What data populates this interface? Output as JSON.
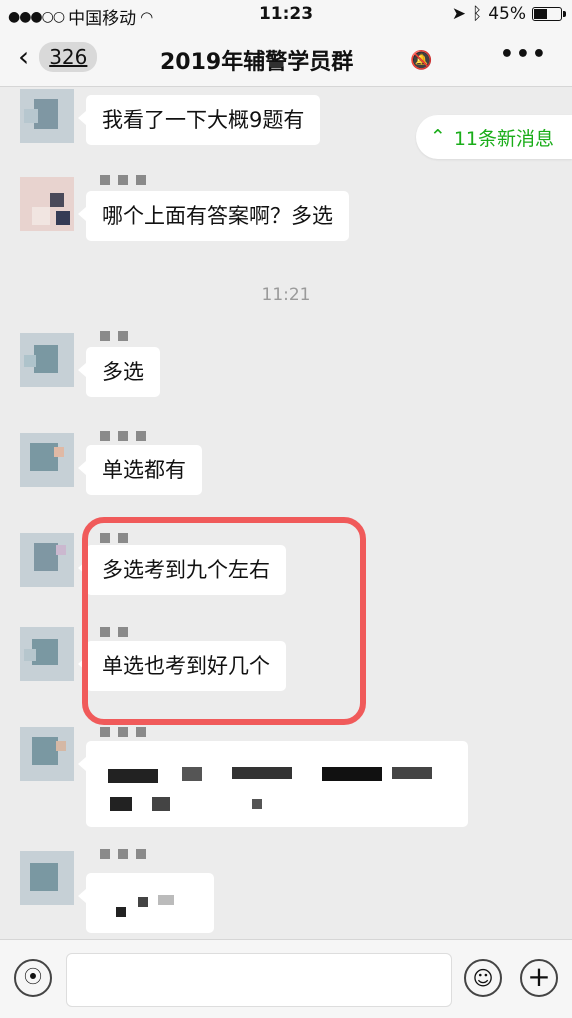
{
  "status_bar": {
    "carrier": "中国移动",
    "time": "11:23",
    "battery": "45%"
  },
  "nav": {
    "back_count": "326",
    "title": "2019年辅警学员群"
  },
  "new_messages": "11条新消息",
  "timestamp": "11:21",
  "messages": [
    {
      "text": "我看了一下大概9题有"
    },
    {
      "text": "哪个上面有答案啊？多选"
    },
    {
      "text": "多选"
    },
    {
      "text": "单选都有"
    },
    {
      "text": "多选考到九个左右"
    },
    {
      "text": "单选也考到好几个"
    }
  ],
  "icons": {
    "back": "chevron-left-icon",
    "mute": "bell-slash-icon",
    "more": "more-icon",
    "voice": "voice-icon",
    "emoji": "emoji-icon",
    "plus": "plus-icon"
  },
  "colors": {
    "accent_green": "#1aad19",
    "highlight_red": "#f05a5a",
    "chat_bg": "#ececec"
  }
}
